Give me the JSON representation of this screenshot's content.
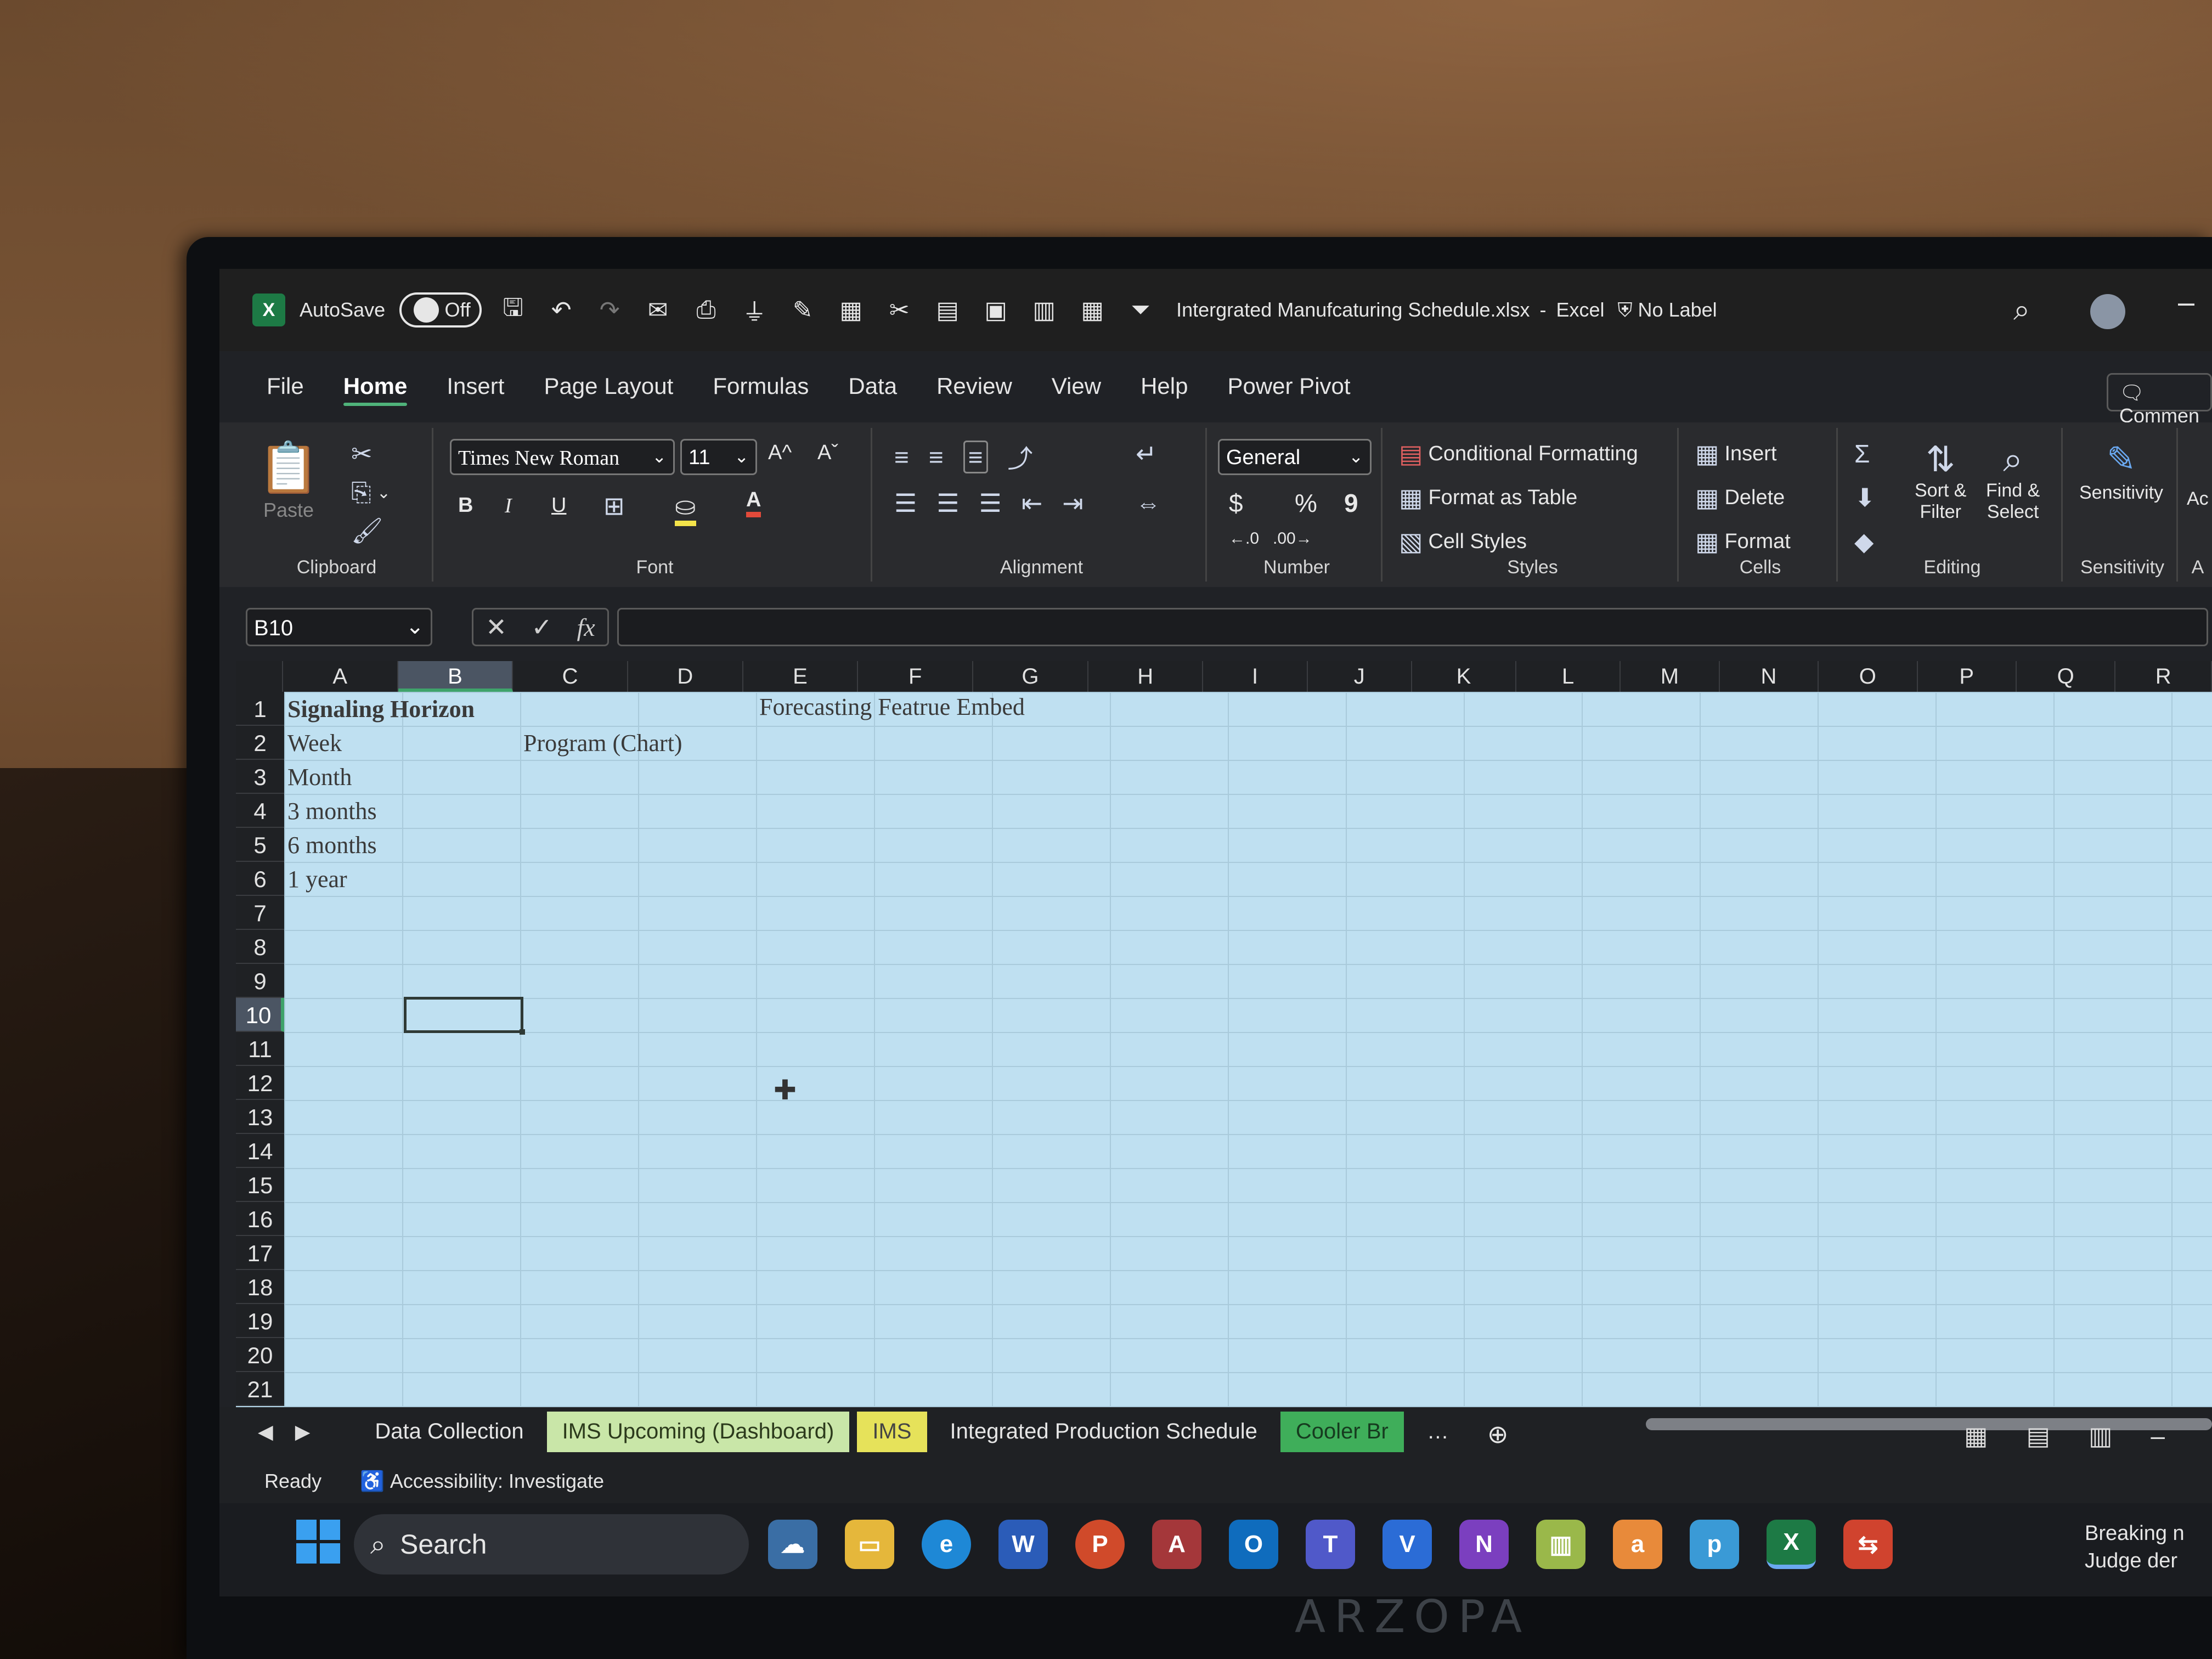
{
  "window": {
    "app_icon": "X",
    "autosave_label": "AutoSave",
    "autosave_state": "Off",
    "document_title": "Intergrated Manufcaturing Schedule.xlsx",
    "separator": "-",
    "app_name": "Excel",
    "sensitivity_label": "No Label"
  },
  "menu": {
    "items": [
      "File",
      "Home",
      "Insert",
      "Page Layout",
      "Formulas",
      "Data",
      "Review",
      "View",
      "Help",
      "Power Pivot"
    ],
    "active": "Home",
    "comments_label": "Commen"
  },
  "ribbon": {
    "clipboard": {
      "label": "Clipboard",
      "paste": "Paste"
    },
    "font": {
      "label": "Font",
      "family": "Times New Roman",
      "size": "11",
      "bold": "B",
      "italic": "I",
      "underline": "U",
      "grow": "A^",
      "shrink": "Aˇ",
      "font_color": "A"
    },
    "alignment": {
      "label": "Alignment"
    },
    "number": {
      "label": "Number",
      "format": "General",
      "currency": "$",
      "percent": "%",
      "comma": "9"
    },
    "styles": {
      "label": "Styles",
      "conditional": "Conditional Formatting",
      "format_table": "Format as Table",
      "cell_styles": "Cell Styles"
    },
    "cells": {
      "label": "Cells",
      "insert": "Insert",
      "delete": "Delete",
      "format": "Format"
    },
    "editing": {
      "label": "Editing",
      "sort_filter_1": "Sort &",
      "sort_filter_2": "Filter",
      "find_select_1": "Find &",
      "find_select_2": "Select"
    },
    "sensitivity": {
      "label": "Sensitivity",
      "button": "Sensitivity",
      "cut_label": "A",
      "cut_button": "Ac"
    }
  },
  "formula_bar": {
    "name_box": "B10",
    "cancel": "✕",
    "enter": "✓",
    "fx": "fx",
    "content": ""
  },
  "columns": [
    "A",
    "B",
    "C",
    "D",
    "E",
    "F",
    "G",
    "H",
    "I",
    "J",
    "K",
    "L",
    "M",
    "N",
    "O",
    "P",
    "Q",
    "R"
  ],
  "rows": [
    "1",
    "2",
    "3",
    "4",
    "5",
    "6",
    "7",
    "8",
    "9",
    "10",
    "11",
    "12",
    "13",
    "14",
    "15",
    "16",
    "17",
    "18",
    "19",
    "20",
    "21"
  ],
  "selected_column": "B",
  "selected_row": "10",
  "cells": {
    "A1": "Signaling Horizon",
    "E1": "Forecasting Featrue Embed",
    "A2": "Week",
    "C2": "Program (Chart)",
    "A3": "Month",
    "A4": "3 months",
    "A5": "6 months",
    "A6": "1 year"
  },
  "sheet_tabs": [
    "Data Collection",
    "IMS Upcoming (Dashboard)",
    "IMS",
    "Integrated Production Schedule",
    "Cooler Br"
  ],
  "tab_colors": {
    "IMS Upcoming (Dashboard)": "#c9e6a8",
    "IMS": "#e6e25a",
    "Cooler Br": "#3fae5a"
  },
  "status": {
    "ready": "Ready",
    "accessibility": "Accessibility: Investigate"
  },
  "taskbar": {
    "search": "Search",
    "news_line1": "Breaking n",
    "news_line2": "Judge der"
  },
  "device_brand": "ARZOPA"
}
